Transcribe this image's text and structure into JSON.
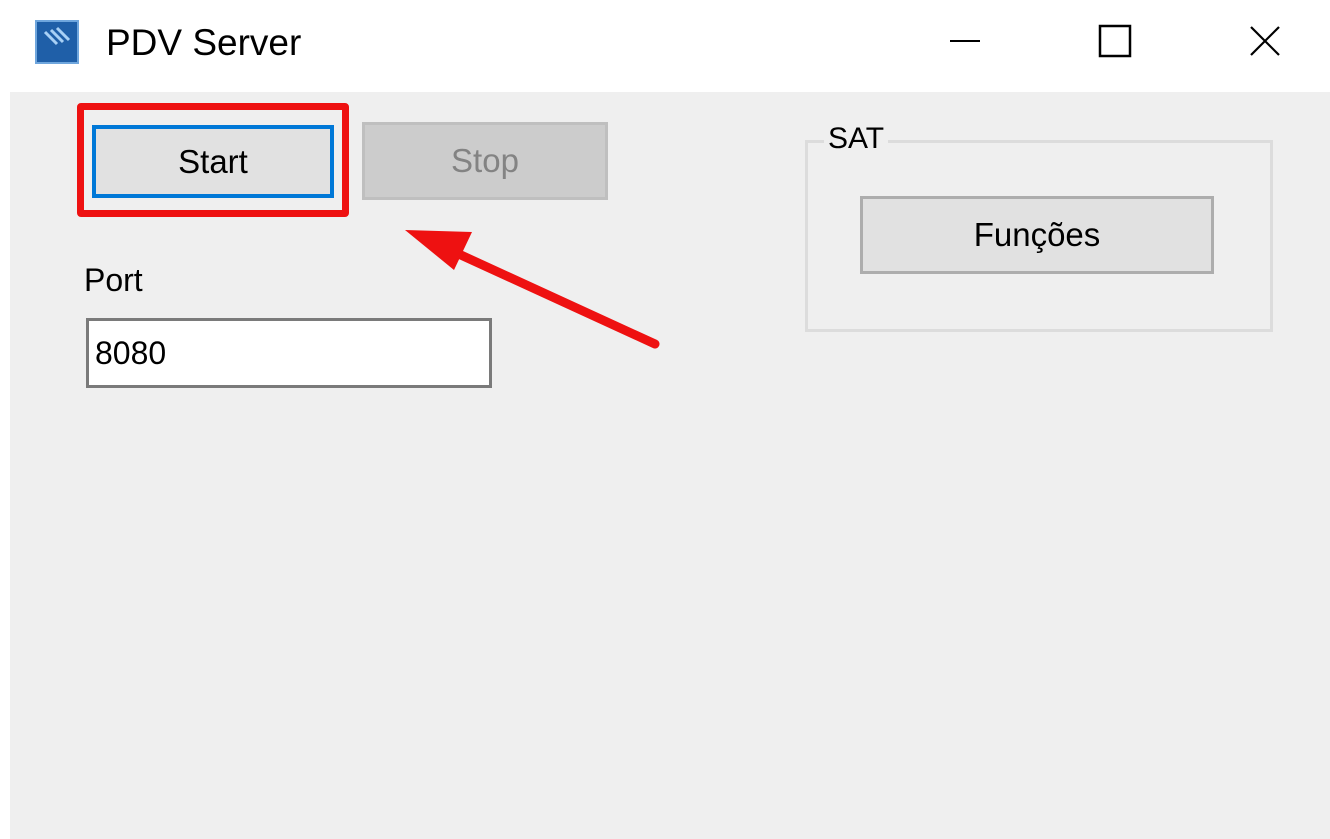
{
  "window": {
    "title": "PDV Server",
    "icon": "app-logo-icon"
  },
  "caption_buttons": {
    "minimize_icon": "minimize-icon",
    "maximize_icon": "maximize-icon",
    "close_icon": "close-icon"
  },
  "controls": {
    "start_label": "Start",
    "stop_label": "Stop",
    "port_label": "Port",
    "port_value": "8080"
  },
  "sat_group": {
    "title": "SAT",
    "funcoes_label": "Funções"
  },
  "annotations": {
    "highlight_color": "#ee1111",
    "arrow_icon": "red-arrow-icon"
  },
  "colors": {
    "focus_border": "#0078d7",
    "client_background": "#efefef"
  }
}
